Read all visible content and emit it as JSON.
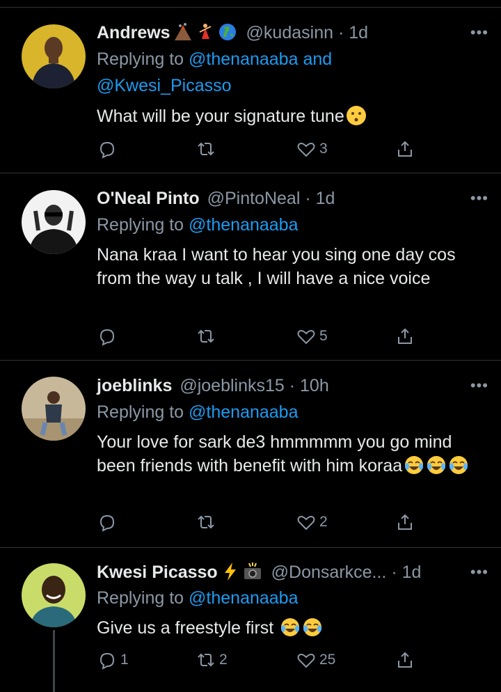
{
  "tweets": [
    {
      "name": "Andrews",
      "name_emojis": [
        "volcano",
        "dancer",
        "globe"
      ],
      "handle": "@kudasinn",
      "time": "· 1d",
      "more": "•••",
      "reply_prefix": "Replying to",
      "reply_mention": "@thenanaaba",
      "reply_and": "and",
      "reply_mention_2": "@Kwesi_Picasso",
      "text": "What will be your signature tune",
      "text_emoji": "hushed-face",
      "reply_count": "",
      "retweet_count": "",
      "like_count": "3",
      "avatar_bg": "#d8b52a"
    },
    {
      "name": "O'Neal Pinto",
      "handle": "@PintoNeal",
      "time": "· 1d",
      "more": "•••",
      "reply_prefix": "Replying to",
      "reply_mention": "@thenanaaba",
      "text": "Nana kraa I want to hear you sing one day cos from the way u talk , I will have a nice voice",
      "reply_count": "",
      "retweet_count": "",
      "like_count": "5",
      "avatar_bg": "#f2f2f2"
    },
    {
      "name": "joeblinks",
      "handle": "@joeblinks15",
      "time": "· 10h",
      "more": "•••",
      "reply_prefix": "Replying to",
      "reply_mention": "@thenanaaba",
      "text": "Your love for sark de3 hmmmmm you go mind been friends with benefit with him koraa",
      "text_emoji": "tears-of-joy x3",
      "reply_count": "",
      "retweet_count": "",
      "like_count": "2",
      "avatar_bg": "#c8b89a"
    },
    {
      "name": "Kwesi Picasso",
      "name_emojis": [
        "lightning",
        "camera-flash"
      ],
      "handle": "@Donsarkce...",
      "time": "· 1d",
      "more": "•••",
      "reply_prefix": "Replying to",
      "reply_mention": "@thenanaaba",
      "text": "Give us a freestyle first",
      "text_emoji": "tears-of-joy x2",
      "reply_count": "1",
      "retweet_count": "2",
      "like_count": "25",
      "avatar_bg": "#c9dc6a"
    }
  ],
  "colors": {
    "bg": "#000000",
    "text": "#e7e9ea",
    "muted": "#8b98a5",
    "link": "#1d9bf0",
    "divider": "#2f3336"
  }
}
